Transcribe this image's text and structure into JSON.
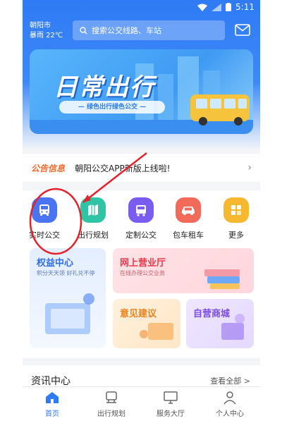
{
  "status_bar": {
    "time": "5:11"
  },
  "header": {
    "city": "朝阳市",
    "weather": "暴雨 22℃",
    "search_placeholder": "搜索公交线路、车站",
    "message_icon": "mail-icon"
  },
  "banner": {
    "title": "日常出行",
    "subtitle": "— 绿色出行绿色公交 —"
  },
  "notice": {
    "tag": "公告信息",
    "text": "朝阳公交APP新版上线啦!"
  },
  "quick_actions": [
    {
      "label": "实时公交",
      "icon": "bus-icon",
      "color": "#4a74f2"
    },
    {
      "label": "出行规划",
      "icon": "map-icon",
      "color": "#2fc4a6"
    },
    {
      "label": "定制公交",
      "icon": "custom-bus-icon",
      "color": "#7a5cf0"
    },
    {
      "label": "包车租车",
      "icon": "car-icon",
      "color": "#f26a5a"
    },
    {
      "label": "更多",
      "icon": "grid-icon",
      "color": "#f5b82e"
    }
  ],
  "cards": {
    "rights": {
      "title": "权益中心",
      "subtitle": "积分天天领 好礼兑不停"
    },
    "hall": {
      "title": "网上营业厅",
      "subtitle": "在线办理公交业务"
    },
    "feedback": {
      "title": "意见建议"
    },
    "shop": {
      "title": "自营商城"
    }
  },
  "news": {
    "title": "资讯中心",
    "more": "查看全部 >"
  },
  "tabbar": [
    {
      "label": "首页",
      "icon": "home-icon",
      "active": true
    },
    {
      "label": "出行规划",
      "icon": "route-icon",
      "active": false
    },
    {
      "label": "服务大厅",
      "icon": "monitor-icon",
      "active": false
    },
    {
      "label": "个人中心",
      "icon": "person-icon",
      "active": false
    }
  ],
  "colors": {
    "primary": "#2f7bf5",
    "annotation": "#e8202a"
  }
}
